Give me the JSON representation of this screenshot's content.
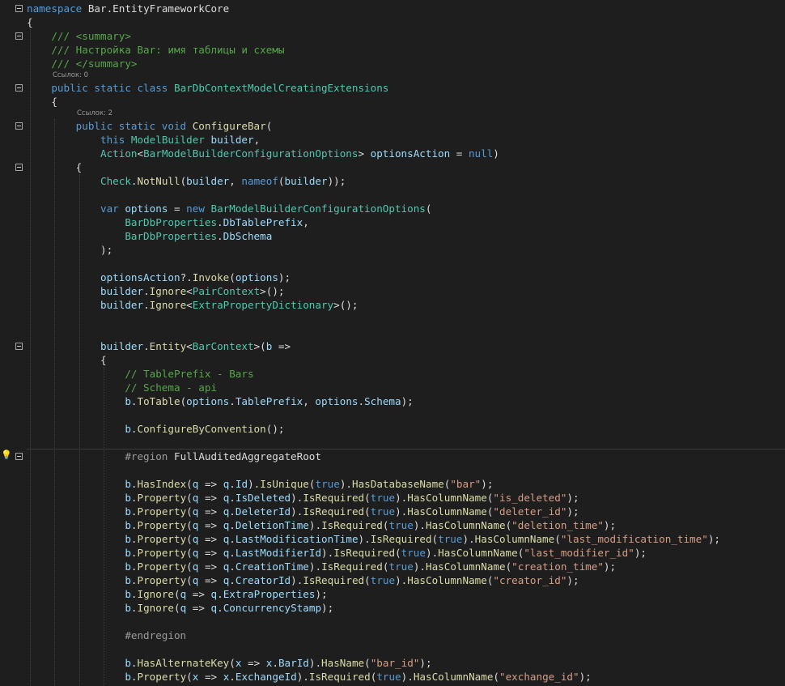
{
  "editor": {
    "language": "C#",
    "theme": "dark",
    "colors": {
      "background": "#1e1e1e",
      "keyword": "#569cd6",
      "type": "#4ec9b0",
      "method": "#dcdcaa",
      "comment": "#57a64a",
      "string": "#d69d85",
      "variable": "#9cdcfe",
      "preprocessor": "#9b9b9b",
      "plain": "#dcdcdc"
    },
    "codelens": [
      "Ссылок: 0",
      "Ссылок: 2"
    ],
    "lines": [
      [
        [
          "kw",
          "namespace"
        ],
        [
          "pl",
          " Bar.EntityFrameworkCore"
        ]
      ],
      [
        [
          "pl",
          "{"
        ]
      ],
      [
        [
          "cm",
          "    /// <summary>"
        ]
      ],
      [
        [
          "cm",
          "    /// Настройка Bar: имя таблицы и схемы"
        ]
      ],
      [
        [
          "cm",
          "    /// </summary>"
        ]
      ],
      [
        [
          "kw",
          "    public static class "
        ],
        [
          "ty",
          "BarDbContextModelCreatingExtensions"
        ]
      ],
      [
        [
          "pl",
          "    {"
        ]
      ],
      [
        [
          "kw",
          "        public static void "
        ],
        [
          "fn",
          "ConfigureBar"
        ],
        [
          "pl",
          "("
        ]
      ],
      [
        [
          "kw",
          "            this "
        ],
        [
          "ty",
          "ModelBuilder"
        ],
        [
          "pl",
          " "
        ],
        [
          "vr",
          "builder"
        ],
        [
          "pl",
          ","
        ]
      ],
      [
        [
          "ty",
          "            Action"
        ],
        [
          "pl",
          "<"
        ],
        [
          "ty",
          "BarModelBuilderConfigurationOptions"
        ],
        [
          "pl",
          "> "
        ],
        [
          "vr",
          "optionsAction"
        ],
        [
          "pl",
          " = "
        ],
        [
          "kw",
          "null"
        ],
        [
          "pl",
          ")"
        ]
      ],
      [
        [
          "pl",
          "        {"
        ]
      ],
      [
        [
          "ty",
          "            Check"
        ],
        [
          "pl",
          "."
        ],
        [
          "fn",
          "NotNull"
        ],
        [
          "pl",
          "("
        ],
        [
          "vr",
          "builder"
        ],
        [
          "pl",
          ", "
        ],
        [
          "kw",
          "nameof"
        ],
        [
          "pl",
          "("
        ],
        [
          "vr",
          "builder"
        ],
        [
          "pl",
          "));"
        ]
      ],
      [
        [
          "pl",
          ""
        ]
      ],
      [
        [
          "kw",
          "            var "
        ],
        [
          "vr",
          "options"
        ],
        [
          "pl",
          " = "
        ],
        [
          "kw",
          "new "
        ],
        [
          "ty",
          "BarModelBuilderConfigurationOptions"
        ],
        [
          "pl",
          "("
        ]
      ],
      [
        [
          "ty",
          "                BarDbProperties"
        ],
        [
          "pl",
          "."
        ],
        [
          "vr",
          "DbTablePrefix"
        ],
        [
          "pl",
          ","
        ]
      ],
      [
        [
          "ty",
          "                BarDbProperties"
        ],
        [
          "pl",
          "."
        ],
        [
          "vr",
          "DbSchema"
        ]
      ],
      [
        [
          "pl",
          "            );"
        ]
      ],
      [
        [
          "pl",
          ""
        ]
      ],
      [
        [
          "vr",
          "            optionsAction"
        ],
        [
          "pl",
          "?."
        ],
        [
          "fn",
          "Invoke"
        ],
        [
          "pl",
          "("
        ],
        [
          "vr",
          "options"
        ],
        [
          "pl",
          ");"
        ]
      ],
      [
        [
          "vr",
          "            builder"
        ],
        [
          "pl",
          "."
        ],
        [
          "fn",
          "Ignore"
        ],
        [
          "pl",
          "<"
        ],
        [
          "ty",
          "PairContext"
        ],
        [
          "pl",
          ">();"
        ]
      ],
      [
        [
          "vr",
          "            builder"
        ],
        [
          "pl",
          "."
        ],
        [
          "fn",
          "Ignore"
        ],
        [
          "pl",
          "<"
        ],
        [
          "ty",
          "ExtraPropertyDictionary"
        ],
        [
          "pl",
          ">();"
        ]
      ],
      [
        [
          "pl",
          ""
        ]
      ],
      [
        [
          "pl",
          ""
        ]
      ],
      [
        [
          "vr",
          "            builder"
        ],
        [
          "pl",
          "."
        ],
        [
          "fn",
          "Entity"
        ],
        [
          "pl",
          "<"
        ],
        [
          "ty",
          "BarContext"
        ],
        [
          "pl",
          ">("
        ],
        [
          "vr",
          "b"
        ],
        [
          "pl",
          " =>"
        ]
      ],
      [
        [
          "pl",
          "            {"
        ]
      ],
      [
        [
          "cm",
          "                // TablePrefix - Bars"
        ]
      ],
      [
        [
          "cm",
          "                // Schema - api"
        ]
      ],
      [
        [
          "vr",
          "                b"
        ],
        [
          "pl",
          "."
        ],
        [
          "fn",
          "ToTable"
        ],
        [
          "pl",
          "("
        ],
        [
          "vr",
          "options"
        ],
        [
          "pl",
          "."
        ],
        [
          "vr",
          "TablePrefix"
        ],
        [
          "pl",
          ", "
        ],
        [
          "vr",
          "options"
        ],
        [
          "pl",
          "."
        ],
        [
          "vr",
          "Schema"
        ],
        [
          "pl",
          ");"
        ]
      ],
      [
        [
          "pl",
          ""
        ]
      ],
      [
        [
          "vr",
          "                b"
        ],
        [
          "pl",
          "."
        ],
        [
          "fn",
          "ConfigureByConvention"
        ],
        [
          "pl",
          "();"
        ]
      ],
      [
        [
          "pl",
          ""
        ]
      ],
      [
        [
          "pr",
          "                #region "
        ],
        [
          "pl",
          "FullAuditedAggregateRoot"
        ]
      ],
      [
        [
          "pl",
          ""
        ]
      ],
      [
        [
          "vr",
          "                b"
        ],
        [
          "pl",
          "."
        ],
        [
          "fn",
          "HasIndex"
        ],
        [
          "pl",
          "("
        ],
        [
          "vr",
          "q"
        ],
        [
          "pl",
          " => "
        ],
        [
          "vr",
          "q"
        ],
        [
          "pl",
          "."
        ],
        [
          "vr",
          "Id"
        ],
        [
          "pl",
          ")."
        ],
        [
          "fn",
          "IsUnique"
        ],
        [
          "pl",
          "("
        ],
        [
          "kw",
          "true"
        ],
        [
          "pl",
          ")."
        ],
        [
          "fn",
          "HasDatabaseName"
        ],
        [
          "pl",
          "("
        ],
        [
          "st",
          "\"bar\""
        ],
        [
          "pl",
          ");"
        ]
      ],
      [
        [
          "vr",
          "                b"
        ],
        [
          "pl",
          "."
        ],
        [
          "fn",
          "Property"
        ],
        [
          "pl",
          "("
        ],
        [
          "vr",
          "q"
        ],
        [
          "pl",
          " => "
        ],
        [
          "vr",
          "q"
        ],
        [
          "pl",
          "."
        ],
        [
          "vr",
          "IsDeleted"
        ],
        [
          "pl",
          ")."
        ],
        [
          "fn",
          "IsRequired"
        ],
        [
          "pl",
          "("
        ],
        [
          "kw",
          "true"
        ],
        [
          "pl",
          ")."
        ],
        [
          "fn",
          "HasColumnName"
        ],
        [
          "pl",
          "("
        ],
        [
          "st",
          "\"is_deleted\""
        ],
        [
          "pl",
          ");"
        ]
      ],
      [
        [
          "vr",
          "                b"
        ],
        [
          "pl",
          "."
        ],
        [
          "fn",
          "Property"
        ],
        [
          "pl",
          "("
        ],
        [
          "vr",
          "q"
        ],
        [
          "pl",
          " => "
        ],
        [
          "vr",
          "q"
        ],
        [
          "pl",
          "."
        ],
        [
          "vr",
          "DeleterId"
        ],
        [
          "pl",
          ")."
        ],
        [
          "fn",
          "IsRequired"
        ],
        [
          "pl",
          "("
        ],
        [
          "kw",
          "true"
        ],
        [
          "pl",
          ")."
        ],
        [
          "fn",
          "HasColumnName"
        ],
        [
          "pl",
          "("
        ],
        [
          "st",
          "\"deleter_id\""
        ],
        [
          "pl",
          ");"
        ]
      ],
      [
        [
          "vr",
          "                b"
        ],
        [
          "pl",
          "."
        ],
        [
          "fn",
          "Property"
        ],
        [
          "pl",
          "("
        ],
        [
          "vr",
          "q"
        ],
        [
          "pl",
          " => "
        ],
        [
          "vr",
          "q"
        ],
        [
          "pl",
          "."
        ],
        [
          "vr",
          "DeletionTime"
        ],
        [
          "pl",
          ")."
        ],
        [
          "fn",
          "IsRequired"
        ],
        [
          "pl",
          "("
        ],
        [
          "kw",
          "true"
        ],
        [
          "pl",
          ")."
        ],
        [
          "fn",
          "HasColumnName"
        ],
        [
          "pl",
          "("
        ],
        [
          "st",
          "\"deletion_time\""
        ],
        [
          "pl",
          ");"
        ]
      ],
      [
        [
          "vr",
          "                b"
        ],
        [
          "pl",
          "."
        ],
        [
          "fn",
          "Property"
        ],
        [
          "pl",
          "("
        ],
        [
          "vr",
          "q"
        ],
        [
          "pl",
          " => "
        ],
        [
          "vr",
          "q"
        ],
        [
          "pl",
          "."
        ],
        [
          "vr",
          "LastModificationTime"
        ],
        [
          "pl",
          ")."
        ],
        [
          "fn",
          "IsRequired"
        ],
        [
          "pl",
          "("
        ],
        [
          "kw",
          "true"
        ],
        [
          "pl",
          ")."
        ],
        [
          "fn",
          "HasColumnName"
        ],
        [
          "pl",
          "("
        ],
        [
          "st",
          "\"last_modification_time\""
        ],
        [
          "pl",
          ");"
        ]
      ],
      [
        [
          "vr",
          "                b"
        ],
        [
          "pl",
          "."
        ],
        [
          "fn",
          "Property"
        ],
        [
          "pl",
          "("
        ],
        [
          "vr",
          "q"
        ],
        [
          "pl",
          " => "
        ],
        [
          "vr",
          "q"
        ],
        [
          "pl",
          "."
        ],
        [
          "vr",
          "LastModifierId"
        ],
        [
          "pl",
          ")."
        ],
        [
          "fn",
          "IsRequired"
        ],
        [
          "pl",
          "("
        ],
        [
          "kw",
          "true"
        ],
        [
          "pl",
          ")."
        ],
        [
          "fn",
          "HasColumnName"
        ],
        [
          "pl",
          "("
        ],
        [
          "st",
          "\"last_modifier_id\""
        ],
        [
          "pl",
          ");"
        ]
      ],
      [
        [
          "vr",
          "                b"
        ],
        [
          "pl",
          "."
        ],
        [
          "fn",
          "Property"
        ],
        [
          "pl",
          "("
        ],
        [
          "vr",
          "q"
        ],
        [
          "pl",
          " => "
        ],
        [
          "vr",
          "q"
        ],
        [
          "pl",
          "."
        ],
        [
          "vr",
          "CreationTime"
        ],
        [
          "pl",
          ")."
        ],
        [
          "fn",
          "IsRequired"
        ],
        [
          "pl",
          "("
        ],
        [
          "kw",
          "true"
        ],
        [
          "pl",
          ")."
        ],
        [
          "fn",
          "HasColumnName"
        ],
        [
          "pl",
          "("
        ],
        [
          "st",
          "\"creation_time\""
        ],
        [
          "pl",
          ");"
        ]
      ],
      [
        [
          "vr",
          "                b"
        ],
        [
          "pl",
          "."
        ],
        [
          "fn",
          "Property"
        ],
        [
          "pl",
          "("
        ],
        [
          "vr",
          "q"
        ],
        [
          "pl",
          " => "
        ],
        [
          "vr",
          "q"
        ],
        [
          "pl",
          "."
        ],
        [
          "vr",
          "CreatorId"
        ],
        [
          "pl",
          ")."
        ],
        [
          "fn",
          "IsRequired"
        ],
        [
          "pl",
          "("
        ],
        [
          "kw",
          "true"
        ],
        [
          "pl",
          ")."
        ],
        [
          "fn",
          "HasColumnName"
        ],
        [
          "pl",
          "("
        ],
        [
          "st",
          "\"creator_id\""
        ],
        [
          "pl",
          ");"
        ]
      ],
      [
        [
          "vr",
          "                b"
        ],
        [
          "pl",
          "."
        ],
        [
          "fn",
          "Ignore"
        ],
        [
          "pl",
          "("
        ],
        [
          "vr",
          "q"
        ],
        [
          "pl",
          " => "
        ],
        [
          "vr",
          "q"
        ],
        [
          "pl",
          "."
        ],
        [
          "vr",
          "ExtraProperties"
        ],
        [
          "pl",
          ");"
        ]
      ],
      [
        [
          "vr",
          "                b"
        ],
        [
          "pl",
          "."
        ],
        [
          "fn",
          "Ignore"
        ],
        [
          "pl",
          "("
        ],
        [
          "vr",
          "q"
        ],
        [
          "pl",
          " => "
        ],
        [
          "vr",
          "q"
        ],
        [
          "pl",
          "."
        ],
        [
          "vr",
          "ConcurrencyStamp"
        ],
        [
          "pl",
          ");"
        ]
      ],
      [
        [
          "pl",
          ""
        ]
      ],
      [
        [
          "pr",
          "                #endregion"
        ]
      ],
      [
        [
          "pl",
          ""
        ]
      ],
      [
        [
          "vr",
          "                b"
        ],
        [
          "pl",
          "."
        ],
        [
          "fn",
          "HasAlternateKey"
        ],
        [
          "pl",
          "("
        ],
        [
          "vr",
          "x"
        ],
        [
          "pl",
          " => "
        ],
        [
          "vr",
          "x"
        ],
        [
          "pl",
          "."
        ],
        [
          "vr",
          "BarId"
        ],
        [
          "pl",
          ")."
        ],
        [
          "fn",
          "HasName"
        ],
        [
          "pl",
          "("
        ],
        [
          "st",
          "\"bar_id\""
        ],
        [
          "pl",
          ");"
        ]
      ],
      [
        [
          "vr",
          "                b"
        ],
        [
          "pl",
          "."
        ],
        [
          "fn",
          "Property"
        ],
        [
          "pl",
          "("
        ],
        [
          "vr",
          "x"
        ],
        [
          "pl",
          " => "
        ],
        [
          "vr",
          "x"
        ],
        [
          "pl",
          "."
        ],
        [
          "vr",
          "ExchangeId"
        ],
        [
          "pl",
          ")."
        ],
        [
          "fn",
          "IsRequired"
        ],
        [
          "pl",
          "("
        ],
        [
          "kw",
          "true"
        ],
        [
          "pl",
          ")."
        ],
        [
          "fn",
          "HasColumnName"
        ],
        [
          "pl",
          "("
        ],
        [
          "st",
          "\"exchange_id\""
        ],
        [
          "pl",
          ");"
        ]
      ]
    ]
  }
}
